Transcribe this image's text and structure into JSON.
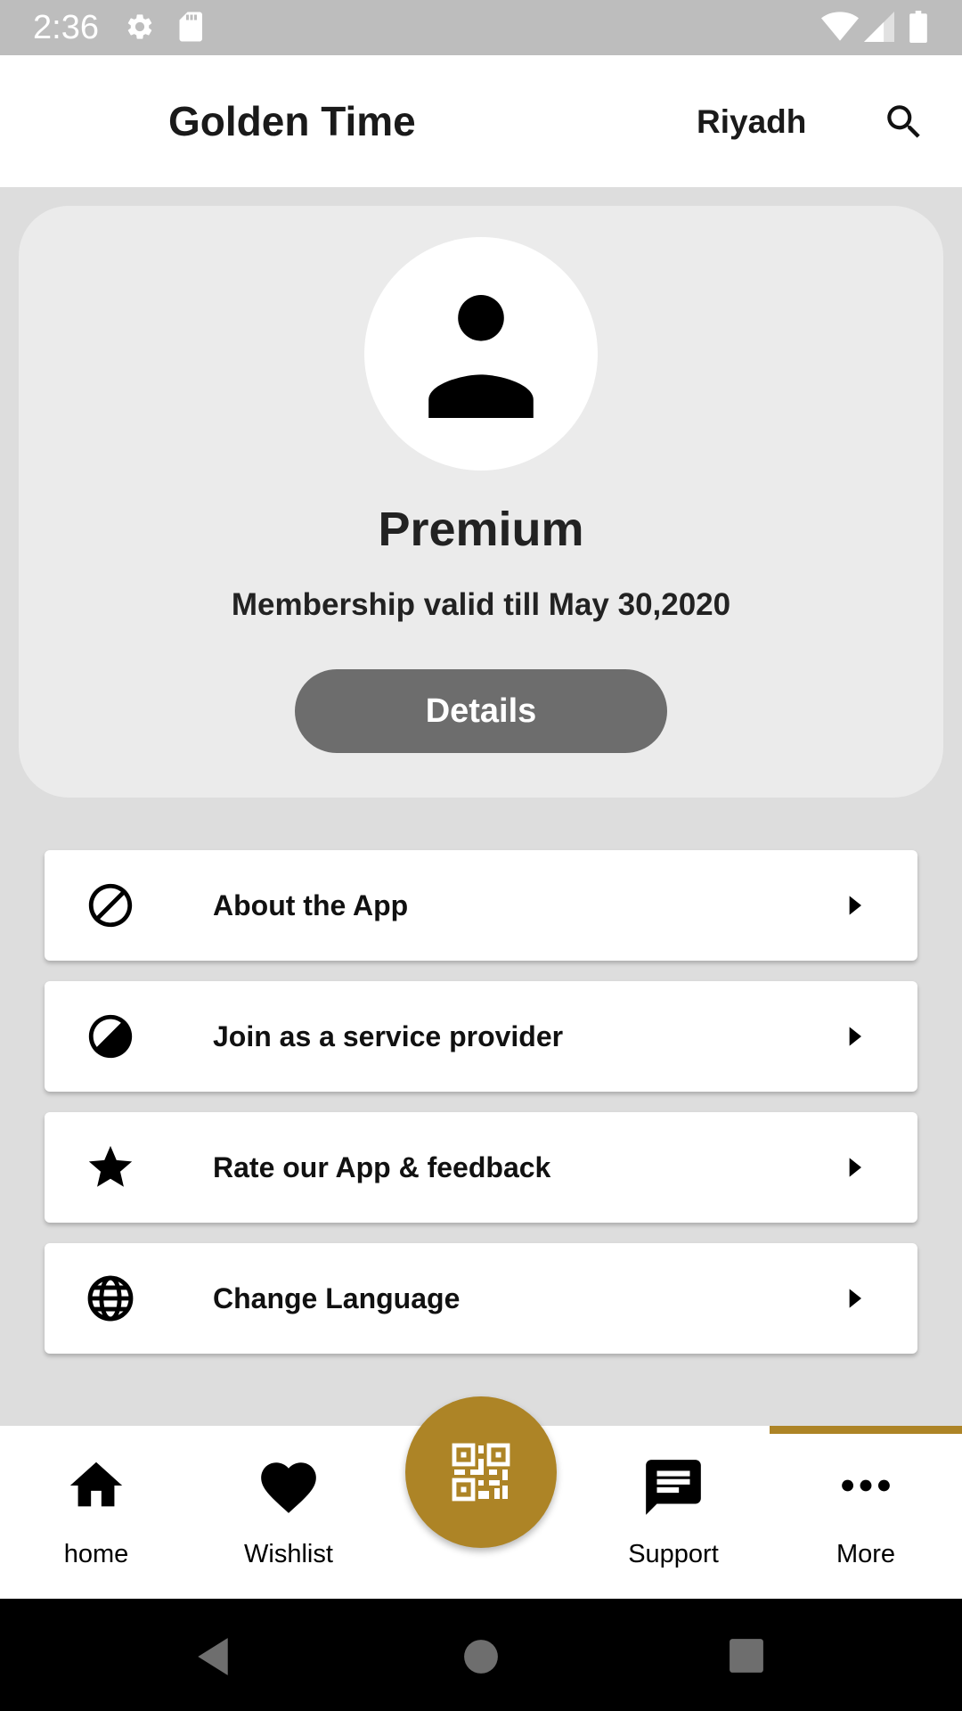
{
  "status_bar": {
    "time": "2:36",
    "icons": [
      "settings-gear-icon",
      "sd-card-icon",
      "wifi-icon",
      "cell-signal-icon",
      "battery-icon"
    ]
  },
  "app_bar": {
    "title": "Golden Time",
    "city": "Riyadh",
    "search_icon": "search-icon"
  },
  "profile": {
    "avatar_icon": "person-icon",
    "tier": "Premium",
    "validity": "Membership valid till May 30,2020",
    "details_label": "Details"
  },
  "menu": [
    {
      "label": "About the App",
      "icon": "block-icon"
    },
    {
      "label": "Join as a service provider",
      "icon": "block-icon"
    },
    {
      "label": "Rate our App & feedback",
      "icon": "star-icon"
    },
    {
      "label": "Change Language",
      "icon": "globe-icon"
    }
  ],
  "bottom_nav": {
    "items": [
      {
        "label": "home",
        "icon": "home-icon"
      },
      {
        "label": "Wishlist",
        "icon": "heart-icon"
      },
      {
        "label": "Support",
        "icon": "chat-icon"
      },
      {
        "label": "More",
        "icon": "more-horizontal-icon"
      }
    ],
    "active": "More",
    "fab_icon": "qr-code-icon"
  },
  "colors": {
    "accent": "#ad8426",
    "details_button": "#6d6d6d",
    "card_bg": "#ebebeb",
    "page_bg": "#dddddd"
  }
}
